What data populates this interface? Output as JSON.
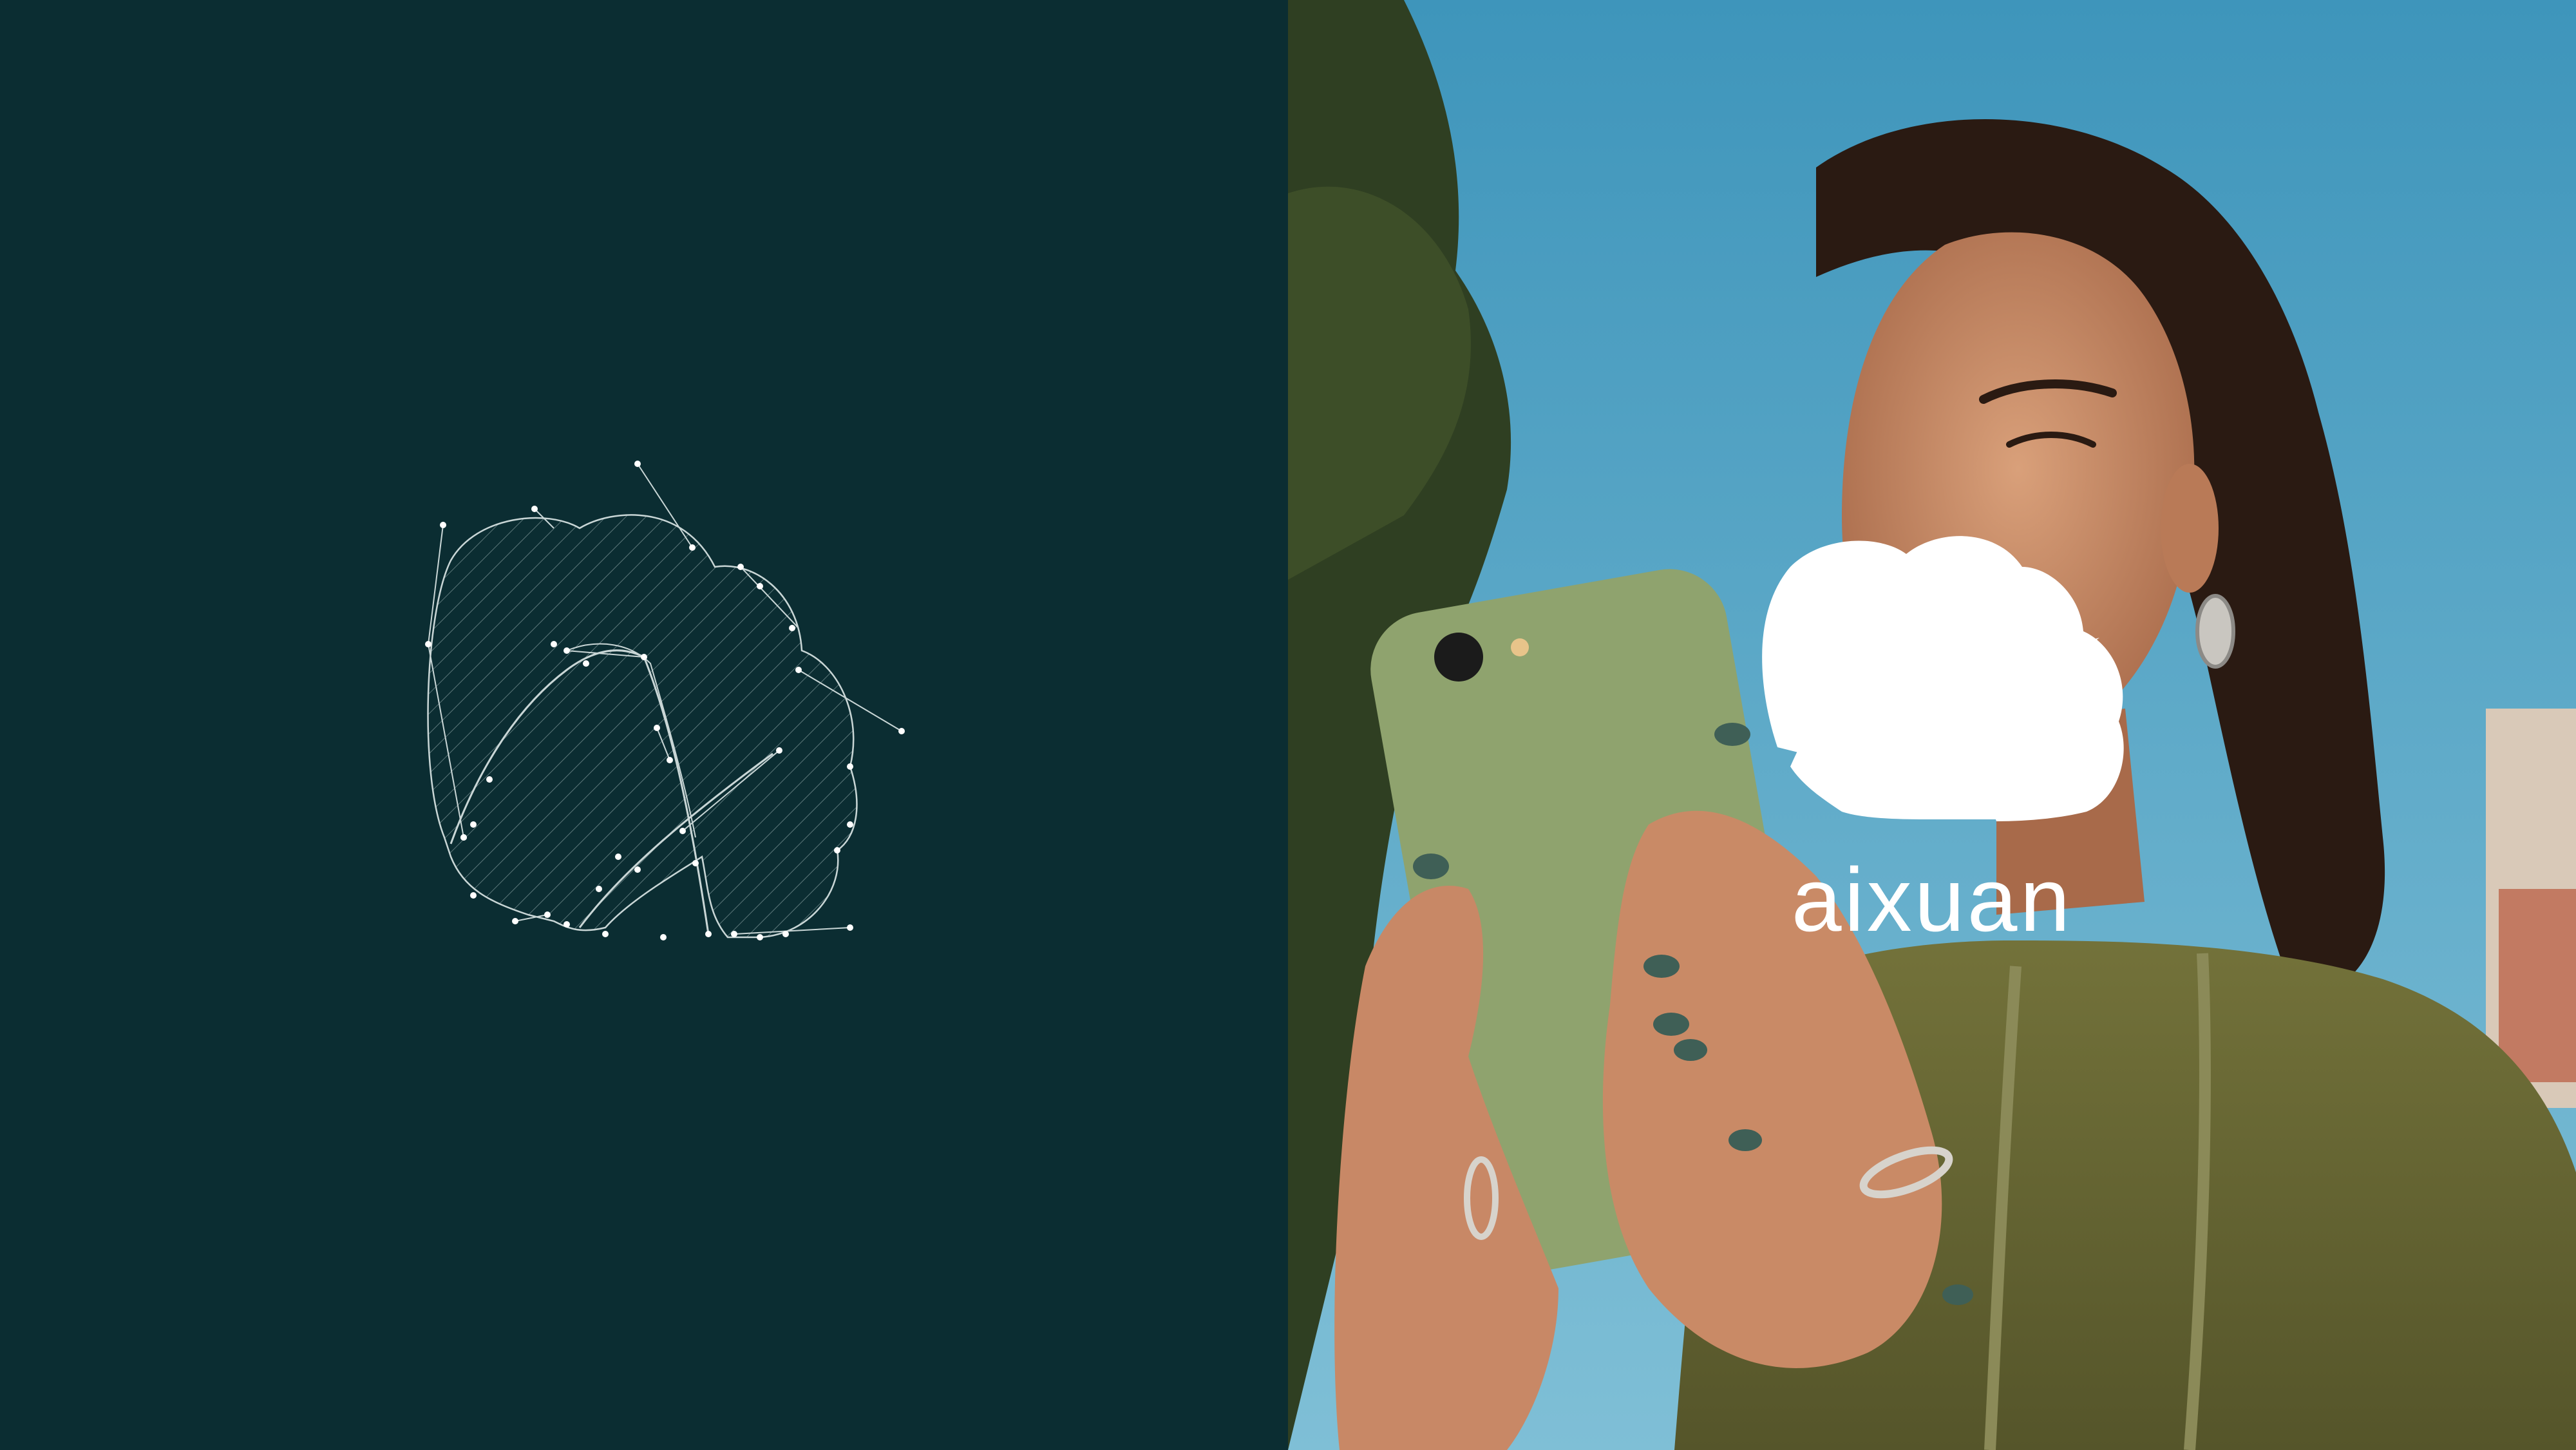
{
  "brand": {
    "wordmark": "aixuan"
  },
  "colors": {
    "panel_bg": "#0b2d32",
    "line": "#c9d6d6",
    "sky": "#4a9fc2",
    "hoodie": "#6b6a33",
    "phone_case": "#8fa36e",
    "nail": "#3f5f56",
    "skin": "#c88866",
    "logo": "#ffffff"
  },
  "left": {
    "content": "logo-construction-drawing"
  },
  "right": {
    "content": "photo-woman-holding-phone-with-logo"
  }
}
